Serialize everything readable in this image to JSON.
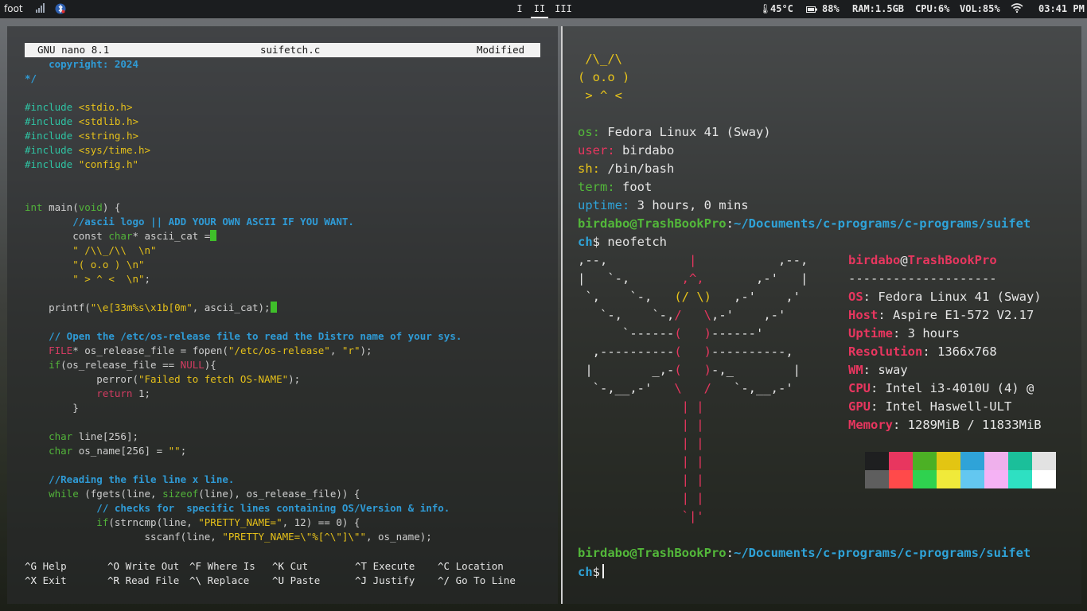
{
  "topbar": {
    "app_name": "foot",
    "workspaces": [
      "I",
      "II",
      "III"
    ],
    "active_workspace": "II",
    "temperature": "45°C",
    "battery": "88%",
    "ram": "RAM:1.5GB",
    "cpu": "CPU:6%",
    "volume": "VOL:85%",
    "clock": "03:41 PM",
    "colors": {
      "temp": "#e8e8e8",
      "ram": "#e8e8e8",
      "cpu": "#e8e8e8",
      "vol": "#e8e8e8"
    }
  },
  "nano": {
    "version": "GNU nano 8.1",
    "filename": "suifetch.c",
    "status": "Modified",
    "lines": [
      [
        [
          "cm",
          "    copyright: 2024"
        ]
      ],
      [
        [
          "cm",
          "*/"
        ]
      ],
      [],
      [
        [
          "pp",
          "#include "
        ],
        [
          "inc",
          "<stdio.h>"
        ]
      ],
      [
        [
          "pp",
          "#include "
        ],
        [
          "inc",
          "<stdlib.h>"
        ]
      ],
      [
        [
          "pp",
          "#include "
        ],
        [
          "inc",
          "<string.h>"
        ]
      ],
      [
        [
          "pp",
          "#include "
        ],
        [
          "inc",
          "<sys/time.h>"
        ]
      ],
      [
        [
          "pp",
          "#include "
        ],
        [
          "inc",
          "\"config.h\""
        ]
      ],
      [],
      [],
      [
        [
          "ty",
          "int"
        ],
        [
          "fn",
          " main("
        ],
        [
          "ty",
          "void"
        ],
        [
          "fn",
          ") {"
        ]
      ],
      [
        [
          "cm",
          "        //ascii logo || ADD YOUR OWN ASCII IF YOU WANT."
        ]
      ],
      [
        [
          "fn",
          "        const "
        ],
        [
          "ty",
          "char"
        ],
        [
          "fn",
          "* ascii_cat ="
        ],
        [
          "cursor",
          ""
        ]
      ],
      [
        [
          "st",
          "        \" /\\\\_/\\\\  \\n\""
        ]
      ],
      [
        [
          "st",
          "        \"( o.o ) \\n\""
        ]
      ],
      [
        [
          "st",
          "        \" > ^ <  \\n\""
        ],
        [
          "fn",
          ";"
        ]
      ],
      [],
      [
        [
          "fn",
          "    printf("
        ],
        [
          "st",
          "\"\\e[33m%s\\x1b[0m\""
        ],
        [
          "fn",
          ", ascii_cat);"
        ],
        [
          "cursor",
          ""
        ]
      ],
      [],
      [
        [
          "cm",
          "    // Open the /etc/os-release file to read the Distro name of your sys."
        ]
      ],
      [
        [
          "kw",
          "    FILE"
        ],
        [
          "fn",
          "* os_release_file = fopen("
        ],
        [
          "st",
          "\"/etc/os-release\""
        ],
        [
          "fn",
          ", "
        ],
        [
          "st",
          "\"r\""
        ],
        [
          "fn",
          ");"
        ]
      ],
      [
        [
          "ty",
          "    if"
        ],
        [
          "fn",
          "(os_release_file == "
        ],
        [
          "kw",
          "NULL"
        ],
        [
          "fn",
          "){"
        ]
      ],
      [
        [
          "fn",
          "            perror("
        ],
        [
          "st",
          "\"Failed to fetch OS-NAME\""
        ],
        [
          "fn",
          ");"
        ]
      ],
      [
        [
          "kw",
          "            return"
        ],
        [
          "fn",
          " 1;"
        ]
      ],
      [
        [
          "fn",
          "        }"
        ]
      ],
      [],
      [
        [
          "ty",
          "    char"
        ],
        [
          "fn",
          " line[256];"
        ]
      ],
      [
        [
          "ty",
          "    char"
        ],
        [
          "fn",
          " os_name[256] = "
        ],
        [
          "st",
          "\"\""
        ],
        [
          "fn",
          ";"
        ]
      ],
      [],
      [
        [
          "cm",
          "    //Reading the file line x line."
        ]
      ],
      [
        [
          "ty",
          "    while"
        ],
        [
          "fn",
          " (fgets(line, "
        ],
        [
          "ty",
          "sizeof"
        ],
        [
          "fn",
          "(line), os_release_file)) {"
        ]
      ],
      [
        [
          "cm",
          "            // checks for  specific lines containing OS/Version & info."
        ]
      ],
      [
        [
          "ty",
          "            if"
        ],
        [
          "fn",
          "(strncmp(line, "
        ],
        [
          "st",
          "\"PRETTY_NAME=\""
        ],
        [
          "fn",
          ", 12) == 0) {"
        ]
      ],
      [
        [
          "fn",
          "                    sscanf(line, "
        ],
        [
          "st",
          "\"PRETTY_NAME=\\\"%[^\\\"]\\\"\""
        ],
        [
          "fn",
          ", os_name);"
        ]
      ]
    ],
    "shortcuts": [
      {
        "key": "^G",
        "label": "Help"
      },
      {
        "key": "^O",
        "label": "Write Out"
      },
      {
        "key": "^F",
        "label": "Where Is"
      },
      {
        "key": "^K",
        "label": "Cut"
      },
      {
        "key": "^T",
        "label": "Execute"
      },
      {
        "key": "^C",
        "label": "Location"
      },
      {
        "key": "^X",
        "label": "Exit"
      },
      {
        "key": "^R",
        "label": "Read File"
      },
      {
        "key": "^\\",
        "label": "Replace"
      },
      {
        "key": "^U",
        "label": "Paste"
      },
      {
        "key": "^J",
        "label": "Justify"
      },
      {
        "key": "^/",
        "label": "Go To Line"
      }
    ]
  },
  "terminal": {
    "cat": [
      " /\\_/\\",
      "( o.o )",
      " > ^ <"
    ],
    "suifetch": [
      {
        "key": "os:",
        "value": "Fedora Linux 41 (Sway)",
        "color": "#53b83a"
      },
      {
        "key": "user:",
        "value": "birdabo",
        "color": "#e8365f"
      },
      {
        "key": "sh:",
        "value": "/bin/bash",
        "color": "#e8c41a"
      },
      {
        "key": "term:",
        "value": "foot",
        "color": "#53b83a"
      },
      {
        "key": "uptime:",
        "value": "3 hours, 0 mins",
        "color": "#2fa3d8"
      }
    ],
    "prompt": {
      "user_host": "birdabo@TrashBookPro",
      "path1": "~/Documents/c-programs/c-programs/suifet",
      "path2": "ch",
      "cmd": "neofetch"
    },
    "neofetch": {
      "user": "birdabo",
      "host": "TrashBookPro",
      "separator": "--------------------",
      "info": [
        {
          "key": "OS",
          "value": "Fedora Linux 41 (Sway)"
        },
        {
          "key": "Host",
          "value": "Aspire E1-572 V2.17"
        },
        {
          "key": "Uptime",
          "value": "3 hours"
        },
        {
          "key": "Resolution",
          "value": "1366x768"
        },
        {
          "key": "WM",
          "value": "sway"
        },
        {
          "key": "CPU",
          "value": "Intel i3-4010U (4) @"
        },
        {
          "key": "GPU",
          "value": "Intel Haswell-ULT"
        },
        {
          "key": "Memory",
          "value": "1289MiB / 11833MiB"
        }
      ],
      "palette_top": [
        "#1e1f20",
        "#e8365f",
        "#4cb025",
        "#e3c512",
        "#2fa3d8",
        "#efb0ec",
        "#1bbf9a",
        "#e2e2e2"
      ],
      "palette_bottom": [
        "#5e5e5e",
        "#ff4a4a",
        "#2fd24f",
        "#f0ea3a",
        "#63c7f0",
        "#f5b2f5",
        "#2ee0c2",
        "#ffffff"
      ]
    }
  }
}
